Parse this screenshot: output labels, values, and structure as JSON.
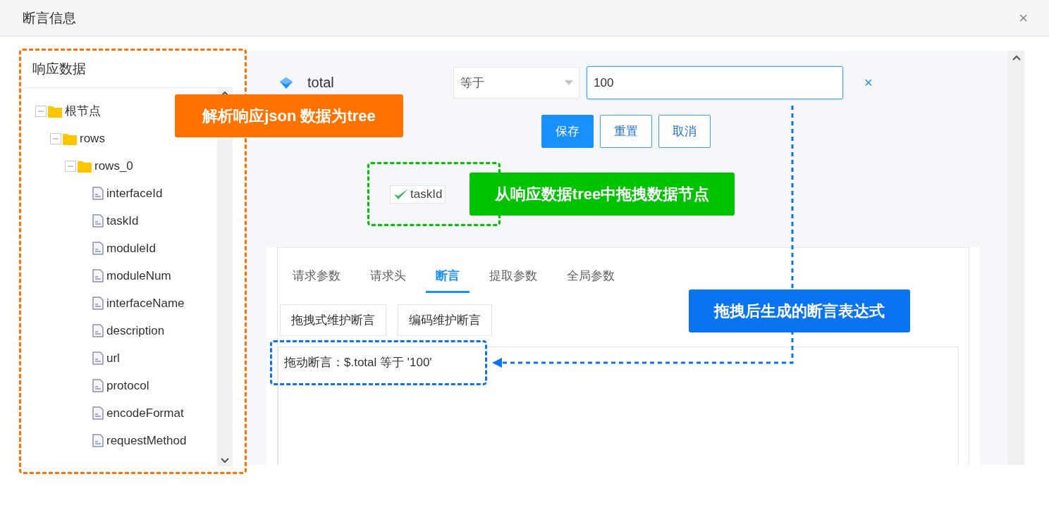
{
  "dialog": {
    "title": "断言信息",
    "close": "×"
  },
  "tree_panel": {
    "title": "响应数据",
    "tree": [
      {
        "label": "根节点",
        "kind": "folder",
        "expanded": true,
        "children": [
          {
            "label": "rows",
            "kind": "folder",
            "expanded": true,
            "children": [
              {
                "label": "rows_0",
                "kind": "folder",
                "expanded": true,
                "children": [
                  {
                    "label": "interfaceId",
                    "kind": "file"
                  },
                  {
                    "label": "taskId",
                    "kind": "file"
                  },
                  {
                    "label": "moduleId",
                    "kind": "file"
                  },
                  {
                    "label": "moduleNum",
                    "kind": "file"
                  },
                  {
                    "label": "interfaceName",
                    "kind": "file"
                  },
                  {
                    "label": "description",
                    "kind": "file"
                  },
                  {
                    "label": "url",
                    "kind": "file"
                  },
                  {
                    "label": "protocol",
                    "kind": "file"
                  },
                  {
                    "label": "encodeFormat",
                    "kind": "file"
                  },
                  {
                    "label": "requestMethod",
                    "kind": "file"
                  }
                ]
              }
            ]
          }
        ]
      }
    ]
  },
  "editor": {
    "field": "total",
    "operator": "等于",
    "value": "100",
    "remove": "×",
    "buttons": [
      {
        "label": "保存",
        "kind": "primary"
      },
      {
        "label": "重置",
        "kind": "default"
      },
      {
        "label": "取消",
        "kind": "default"
      }
    ],
    "dragged_node": "taskId"
  },
  "tabs": [
    {
      "label": "请求参数",
      "selected": false
    },
    {
      "label": "请求头",
      "selected": false
    },
    {
      "label": "断言",
      "selected": true
    },
    {
      "label": "提取参数",
      "selected": false
    },
    {
      "label": "全局参数",
      "selected": false
    }
  ],
  "mode_buttons": [
    "拖拽式维护断言",
    "编码维护断言"
  ],
  "assertion_text": "拖动断言：$.total 等于 '100'",
  "annotations": [
    {
      "text": "解析响应json 数据为tree",
      "color": "#ff7200"
    },
    {
      "text": "从响应数据tree中拖拽数据节点",
      "color": "#00c300"
    },
    {
      "text": "拖拽后生成的断言表达式",
      "color": "#0a74f0"
    }
  ]
}
